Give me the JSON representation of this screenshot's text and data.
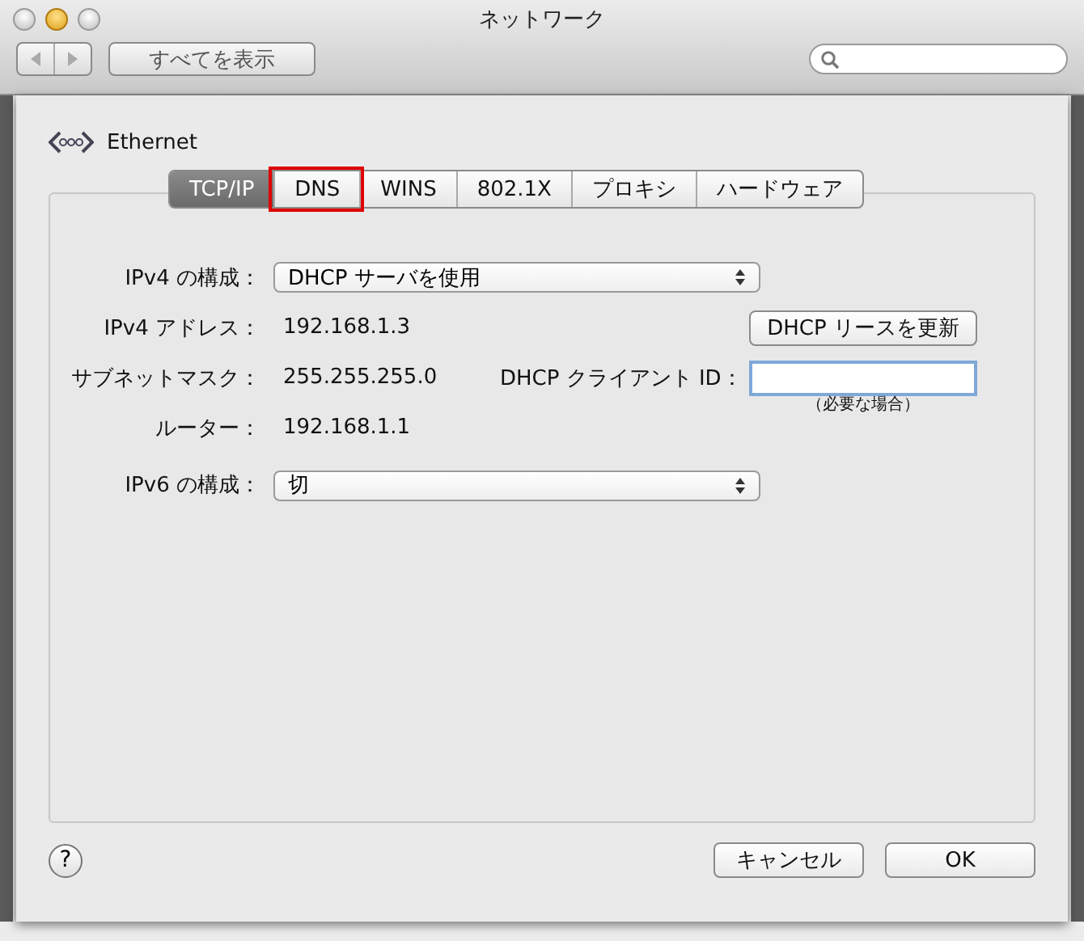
{
  "window": {
    "title": "ネットワーク",
    "show_all_button": "すべてを表示"
  },
  "sheet": {
    "interface": "Ethernet",
    "tabs": [
      {
        "label": "TCP/IP",
        "selected": true,
        "highlighted": false
      },
      {
        "label": "DNS",
        "selected": false,
        "highlighted": true
      },
      {
        "label": "WINS",
        "selected": false,
        "highlighted": false
      },
      {
        "label": "802.1X",
        "selected": false,
        "highlighted": false
      },
      {
        "label": "プロキシ",
        "selected": false,
        "highlighted": false
      },
      {
        "label": "ハードウェア",
        "selected": false,
        "highlighted": false
      }
    ],
    "ipv4_config": {
      "label": "IPv4 の構成：",
      "value": "DHCP サーバを使用"
    },
    "ipv4_address": {
      "label": "IPv4 アドレス：",
      "value": "192.168.1.3"
    },
    "subnet_mask": {
      "label": "サブネットマスク：",
      "value": "255.255.255.0"
    },
    "router": {
      "label": "ルーター：",
      "value": "192.168.1.1"
    },
    "renew_button": "DHCP リースを更新",
    "client_id": {
      "label": "DHCP クライアント ID：",
      "hint": "（必要な場合）"
    },
    "ipv6_config": {
      "label": "IPv6 の構成：",
      "value": "切"
    },
    "help": "?",
    "buttons": [
      "キャンセル",
      "OK"
    ]
  }
}
